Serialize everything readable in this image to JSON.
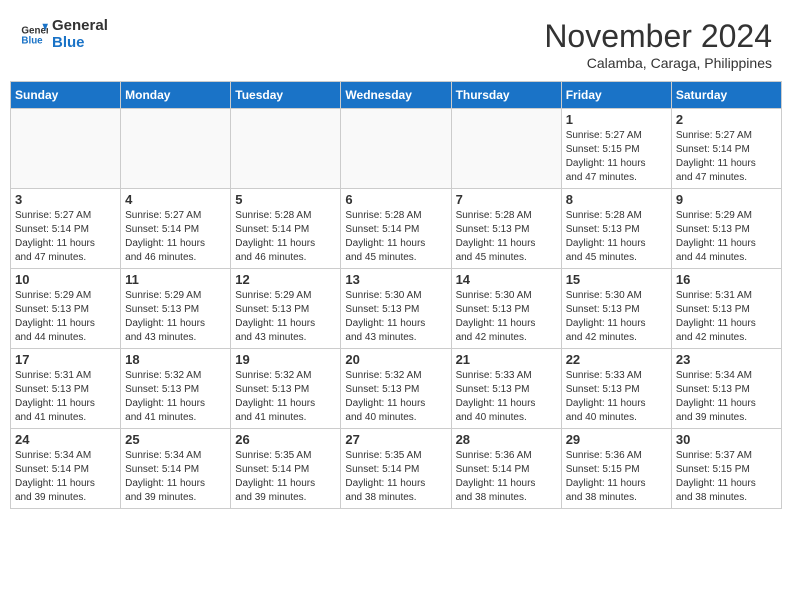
{
  "header": {
    "logo_line1": "General",
    "logo_line2": "Blue",
    "month": "November 2024",
    "location": "Calamba, Caraga, Philippines"
  },
  "weekdays": [
    "Sunday",
    "Monday",
    "Tuesday",
    "Wednesday",
    "Thursday",
    "Friday",
    "Saturday"
  ],
  "weeks": [
    [
      {
        "day": "",
        "info": ""
      },
      {
        "day": "",
        "info": ""
      },
      {
        "day": "",
        "info": ""
      },
      {
        "day": "",
        "info": ""
      },
      {
        "day": "",
        "info": ""
      },
      {
        "day": "1",
        "info": "Sunrise: 5:27 AM\nSunset: 5:15 PM\nDaylight: 11 hours\nand 47 minutes."
      },
      {
        "day": "2",
        "info": "Sunrise: 5:27 AM\nSunset: 5:14 PM\nDaylight: 11 hours\nand 47 minutes."
      }
    ],
    [
      {
        "day": "3",
        "info": "Sunrise: 5:27 AM\nSunset: 5:14 PM\nDaylight: 11 hours\nand 47 minutes."
      },
      {
        "day": "4",
        "info": "Sunrise: 5:27 AM\nSunset: 5:14 PM\nDaylight: 11 hours\nand 46 minutes."
      },
      {
        "day": "5",
        "info": "Sunrise: 5:28 AM\nSunset: 5:14 PM\nDaylight: 11 hours\nand 46 minutes."
      },
      {
        "day": "6",
        "info": "Sunrise: 5:28 AM\nSunset: 5:14 PM\nDaylight: 11 hours\nand 45 minutes."
      },
      {
        "day": "7",
        "info": "Sunrise: 5:28 AM\nSunset: 5:13 PM\nDaylight: 11 hours\nand 45 minutes."
      },
      {
        "day": "8",
        "info": "Sunrise: 5:28 AM\nSunset: 5:13 PM\nDaylight: 11 hours\nand 45 minutes."
      },
      {
        "day": "9",
        "info": "Sunrise: 5:29 AM\nSunset: 5:13 PM\nDaylight: 11 hours\nand 44 minutes."
      }
    ],
    [
      {
        "day": "10",
        "info": "Sunrise: 5:29 AM\nSunset: 5:13 PM\nDaylight: 11 hours\nand 44 minutes."
      },
      {
        "day": "11",
        "info": "Sunrise: 5:29 AM\nSunset: 5:13 PM\nDaylight: 11 hours\nand 43 minutes."
      },
      {
        "day": "12",
        "info": "Sunrise: 5:29 AM\nSunset: 5:13 PM\nDaylight: 11 hours\nand 43 minutes."
      },
      {
        "day": "13",
        "info": "Sunrise: 5:30 AM\nSunset: 5:13 PM\nDaylight: 11 hours\nand 43 minutes."
      },
      {
        "day": "14",
        "info": "Sunrise: 5:30 AM\nSunset: 5:13 PM\nDaylight: 11 hours\nand 42 minutes."
      },
      {
        "day": "15",
        "info": "Sunrise: 5:30 AM\nSunset: 5:13 PM\nDaylight: 11 hours\nand 42 minutes."
      },
      {
        "day": "16",
        "info": "Sunrise: 5:31 AM\nSunset: 5:13 PM\nDaylight: 11 hours\nand 42 minutes."
      }
    ],
    [
      {
        "day": "17",
        "info": "Sunrise: 5:31 AM\nSunset: 5:13 PM\nDaylight: 11 hours\nand 41 minutes."
      },
      {
        "day": "18",
        "info": "Sunrise: 5:32 AM\nSunset: 5:13 PM\nDaylight: 11 hours\nand 41 minutes."
      },
      {
        "day": "19",
        "info": "Sunrise: 5:32 AM\nSunset: 5:13 PM\nDaylight: 11 hours\nand 41 minutes."
      },
      {
        "day": "20",
        "info": "Sunrise: 5:32 AM\nSunset: 5:13 PM\nDaylight: 11 hours\nand 40 minutes."
      },
      {
        "day": "21",
        "info": "Sunrise: 5:33 AM\nSunset: 5:13 PM\nDaylight: 11 hours\nand 40 minutes."
      },
      {
        "day": "22",
        "info": "Sunrise: 5:33 AM\nSunset: 5:13 PM\nDaylight: 11 hours\nand 40 minutes."
      },
      {
        "day": "23",
        "info": "Sunrise: 5:34 AM\nSunset: 5:13 PM\nDaylight: 11 hours\nand 39 minutes."
      }
    ],
    [
      {
        "day": "24",
        "info": "Sunrise: 5:34 AM\nSunset: 5:14 PM\nDaylight: 11 hours\nand 39 minutes."
      },
      {
        "day": "25",
        "info": "Sunrise: 5:34 AM\nSunset: 5:14 PM\nDaylight: 11 hours\nand 39 minutes."
      },
      {
        "day": "26",
        "info": "Sunrise: 5:35 AM\nSunset: 5:14 PM\nDaylight: 11 hours\nand 39 minutes."
      },
      {
        "day": "27",
        "info": "Sunrise: 5:35 AM\nSunset: 5:14 PM\nDaylight: 11 hours\nand 38 minutes."
      },
      {
        "day": "28",
        "info": "Sunrise: 5:36 AM\nSunset: 5:14 PM\nDaylight: 11 hours\nand 38 minutes."
      },
      {
        "day": "29",
        "info": "Sunrise: 5:36 AM\nSunset: 5:15 PM\nDaylight: 11 hours\nand 38 minutes."
      },
      {
        "day": "30",
        "info": "Sunrise: 5:37 AM\nSunset: 5:15 PM\nDaylight: 11 hours\nand 38 minutes."
      }
    ]
  ]
}
